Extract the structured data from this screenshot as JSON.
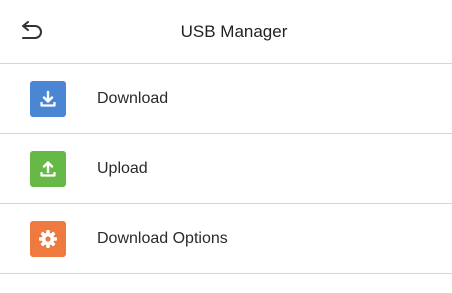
{
  "header": {
    "title": "USB Manager",
    "back_icon": "back-arrow-icon"
  },
  "menu": {
    "items": [
      {
        "label": "Download",
        "icon": "download-icon",
        "color": "#4a86d4"
      },
      {
        "label": "Upload",
        "icon": "upload-icon",
        "color": "#67b947"
      },
      {
        "label": "Download Options",
        "icon": "gear-icon",
        "color": "#ef7a3f"
      }
    ]
  }
}
